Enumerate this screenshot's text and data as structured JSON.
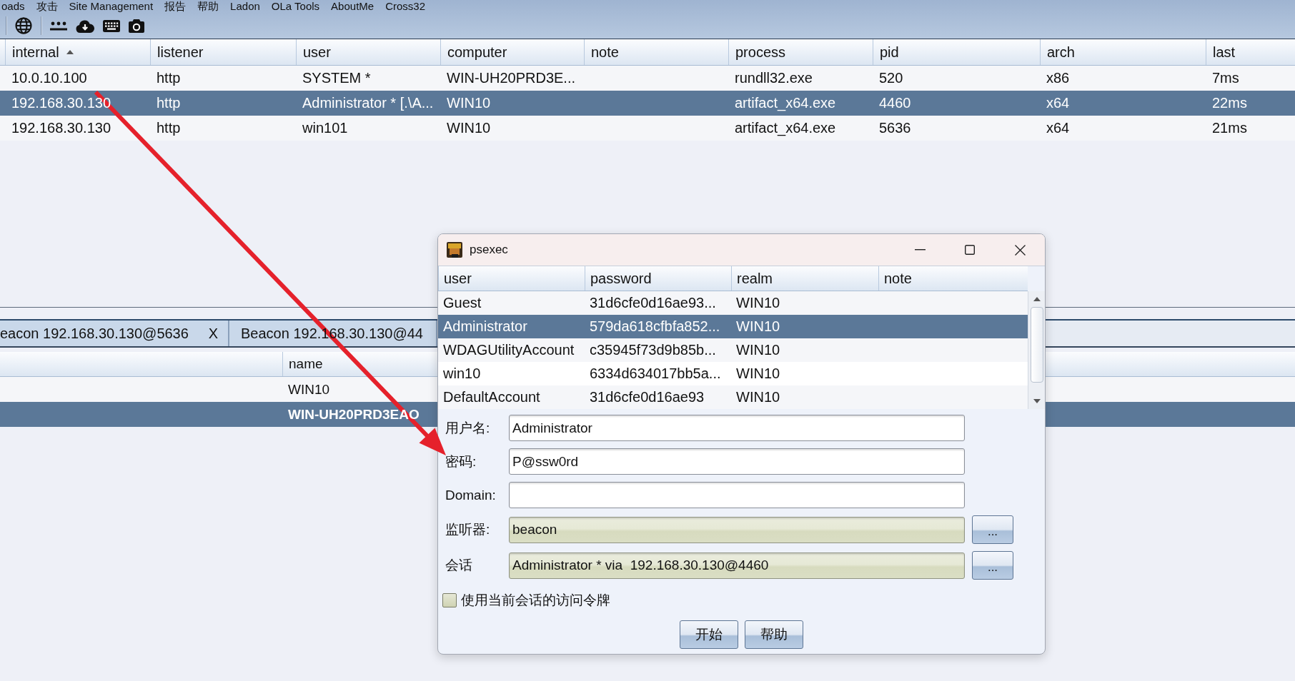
{
  "menu_bar": {
    "items": [
      "oads",
      "攻击",
      "Site Management",
      "报告",
      "帮助",
      "Ladon",
      "OLa Tools",
      "AboutMe",
      "Cross32"
    ]
  },
  "sessions_table": {
    "columns": [
      {
        "label": "internal",
        "sorted": true
      },
      {
        "label": "listener",
        "sorted": false
      },
      {
        "label": "user",
        "sorted": false
      },
      {
        "label": "computer",
        "sorted": false
      },
      {
        "label": "note",
        "sorted": false
      },
      {
        "label": "process",
        "sorted": false
      },
      {
        "label": "pid",
        "sorted": false
      },
      {
        "label": "arch",
        "sorted": false
      },
      {
        "label": "last",
        "sorted": false
      }
    ],
    "rows": [
      {
        "internal": "10.0.10.100",
        "listener": "http",
        "user": "SYSTEM *",
        "computer": "WIN-UH20PRD3E...",
        "process": "rundll32.exe",
        "pid": "520",
        "arch": "x86",
        "last": "7ms",
        "selected": false
      },
      {
        "internal": "192.168.30.130",
        "listener": "http",
        "user": "Administrator * [.\\A...",
        "computer": "WIN10",
        "process": "artifact_x64.exe",
        "pid": "4460",
        "arch": "x64",
        "last": "22ms",
        "selected": true
      },
      {
        "internal": "192.168.30.130",
        "listener": "http",
        "user": "win101",
        "computer": "WIN10",
        "process": "artifact_x64.exe",
        "pid": "5636",
        "arch": "x64",
        "last": "21ms",
        "selected": false
      }
    ]
  },
  "tabs": [
    {
      "label": "eacon 192.168.30.130@5636",
      "close": "X",
      "selected": false
    },
    {
      "label": "Beacon 192.168.30.130@44",
      "selected": false
    }
  ],
  "targets_table": {
    "columns": [
      {
        "label": "name"
      }
    ],
    "rows": [
      {
        "name": "WIN10",
        "selected": false
      },
      {
        "name": "WIN-UH20PRD3EAO",
        "selected": true
      }
    ]
  },
  "dialog": {
    "title": "psexec",
    "credentials_table": {
      "columns": [
        {
          "label": "user"
        },
        {
          "label": "password"
        },
        {
          "label": "realm"
        },
        {
          "label": "note"
        }
      ],
      "rows": [
        {
          "user": "Guest",
          "password": "31d6cfe0d16ae93...",
          "realm": "WIN10",
          "selected": false
        },
        {
          "user": "Administrator",
          "password": "579da618cfbfa852...",
          "realm": "WIN10",
          "selected": true
        },
        {
          "user": "WDAGUtilityAccount",
          "password": "c35945f73d9b85b...",
          "realm": "WIN10",
          "selected": false
        },
        {
          "user": "win10",
          "password": "6334d634017bb5a...",
          "realm": "WIN10",
          "selected": false
        },
        {
          "user": "DefaultAccount",
          "password": "31d6cfe0d16ae93",
          "realm": "WIN10",
          "selected": false
        }
      ]
    },
    "fields": [
      {
        "kind": "text",
        "label": "用户名:",
        "value": "Administrator"
      },
      {
        "kind": "text",
        "label": "密码:",
        "value": "P@ssw0rd"
      },
      {
        "kind": "text",
        "label": "Domain:"
      },
      {
        "kind": "picker",
        "label": "监听器:",
        "value": "beacon",
        "button": "..."
      },
      {
        "kind": "picker",
        "label": "会话",
        "value": "Administrator * via  192.168.30.130@4460",
        "button": "..."
      }
    ],
    "checkbox": {
      "label": "使用当前会话的访问令牌",
      "checked": false
    },
    "buttons": [
      "开始",
      "帮助"
    ]
  }
}
